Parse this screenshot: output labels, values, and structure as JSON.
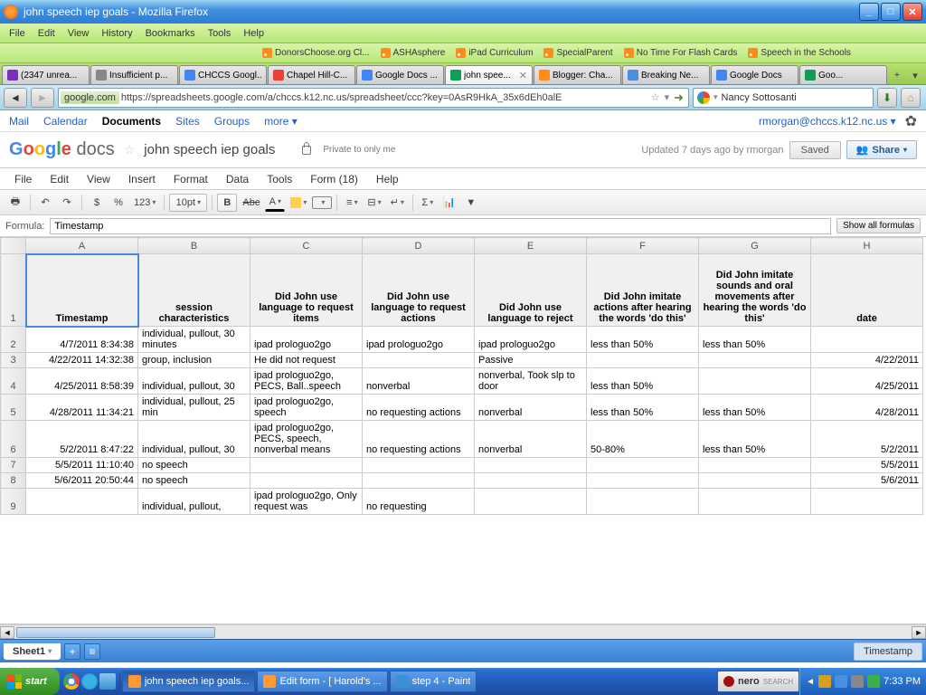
{
  "window": {
    "title": "john speech iep goals - Mozilla Firefox"
  },
  "firefox_menu": [
    "File",
    "Edit",
    "View",
    "History",
    "Bookmarks",
    "Tools",
    "Help"
  ],
  "bookmarks": [
    "DonorsChoose.org Cl...",
    "ASHAsphere",
    "iPad Curriculum",
    "SpecialParent",
    "No Time For Flash Cards",
    "Speech in the Schools"
  ],
  "tabs": [
    {
      "label": "(2347 unrea..."
    },
    {
      "label": "Insufficient p..."
    },
    {
      "label": "CHCCS Googl..."
    },
    {
      "label": "Chapel Hill-C..."
    },
    {
      "label": "Google Docs ..."
    },
    {
      "label": "john spee...",
      "active": true
    },
    {
      "label": "Blogger: Cha..."
    },
    {
      "label": "Breaking Ne..."
    },
    {
      "label": "Google Docs"
    },
    {
      "label": "Goo..."
    }
  ],
  "url": {
    "domain": "google.com",
    "path": "https://spreadsheets.google.com/a/chccs.k12.nc.us/spreadsheet/ccc?key=0AsR9HkA_35x6dEh0alE"
  },
  "search_persona": "Nancy Sottosanti",
  "gbar": {
    "links": [
      "Mail",
      "Calendar",
      "Documents",
      "Sites",
      "Groups",
      "more ▾"
    ],
    "activeIndex": 2,
    "email": "rmorgan@chccs.k12.nc.us ▾"
  },
  "docs": {
    "title": "john speech iep goals",
    "privacy": "Private to only me",
    "updated": "Updated 7 days ago by rmorgan",
    "saved": "Saved",
    "share": "Share"
  },
  "docs_menu": [
    "File",
    "Edit",
    "View",
    "Insert",
    "Format",
    "Data",
    "Tools",
    "Form (18)",
    "Help"
  ],
  "formula": {
    "label": "Formula:",
    "value": "Timestamp",
    "btn": "Show all formulas"
  },
  "toolbar_font": "10pt",
  "toolbar_fmt": "123",
  "columns": [
    "A",
    "B",
    "C",
    "D",
    "E",
    "F",
    "G",
    "H"
  ],
  "headers": [
    "Timestamp",
    "session characteristics",
    "Did John use language to request items",
    "Did John use language to request actions",
    "Did John use language to reject",
    "Did John imitate actions after hearing the words 'do this'",
    "Did John imitate sounds and oral movements after hearing the words 'do this'",
    "date"
  ],
  "rows": [
    {
      "n": "2",
      "c": [
        "4/7/2011 8:34:38",
        "individual, pullout, 30 minutes",
        "ipad prologuo2go",
        "ipad prologuo2go",
        "ipad prologuo2go",
        "less than 50%",
        "less than 50%",
        ""
      ]
    },
    {
      "n": "3",
      "c": [
        "4/22/2011 14:32:38",
        "group, inclusion",
        "He did not request",
        "",
        "Passive",
        "",
        "",
        "4/22/2011"
      ]
    },
    {
      "n": "4",
      "c": [
        "4/25/2011 8:58:39",
        "individual, pullout, 30",
        "ipad prologuo2go, PECS, Ball..speech",
        "nonverbal",
        "nonverbal, Took slp to door",
        "less than 50%",
        "",
        "4/25/2011"
      ]
    },
    {
      "n": "5",
      "c": [
        "4/28/2011 11:34:21",
        "individual, pullout, 25 min",
        "ipad prologuo2go, speech",
        "no requesting actions",
        "nonverbal",
        "less than 50%",
        "less than 50%",
        "4/28/2011"
      ]
    },
    {
      "n": "6",
      "c": [
        "5/2/2011 8:47:22",
        "individual, pullout, 30",
        "ipad prologuo2go, PECS, speech, nonverbal means",
        "no requesting actions",
        "nonverbal",
        "50-80%",
        "less than 50%",
        "5/2/2011"
      ]
    },
    {
      "n": "7",
      "c": [
        "5/5/2011 11:10:40",
        "no speech",
        "",
        "",
        "",
        "",
        "",
        "5/5/2011"
      ]
    },
    {
      "n": "8",
      "c": [
        "5/6/2011 20:50:44",
        "no speech",
        "",
        "",
        "",
        "",
        "",
        "5/6/2011"
      ]
    },
    {
      "n": "9",
      "c": [
        "",
        "individual, pullout,",
        "ipad prologuo2go, Only request was",
        "no requesting",
        "",
        "",
        "",
        ""
      ]
    }
  ],
  "sheet_tab": "Sheet1",
  "status_cell": "Timestamp",
  "taskbar": {
    "start": "start",
    "items": [
      "john speech iep goals...",
      "Edit form - [ Harold's ...",
      "step 4 - Paint"
    ],
    "nero": "nero",
    "clock": "7:33 PM"
  }
}
